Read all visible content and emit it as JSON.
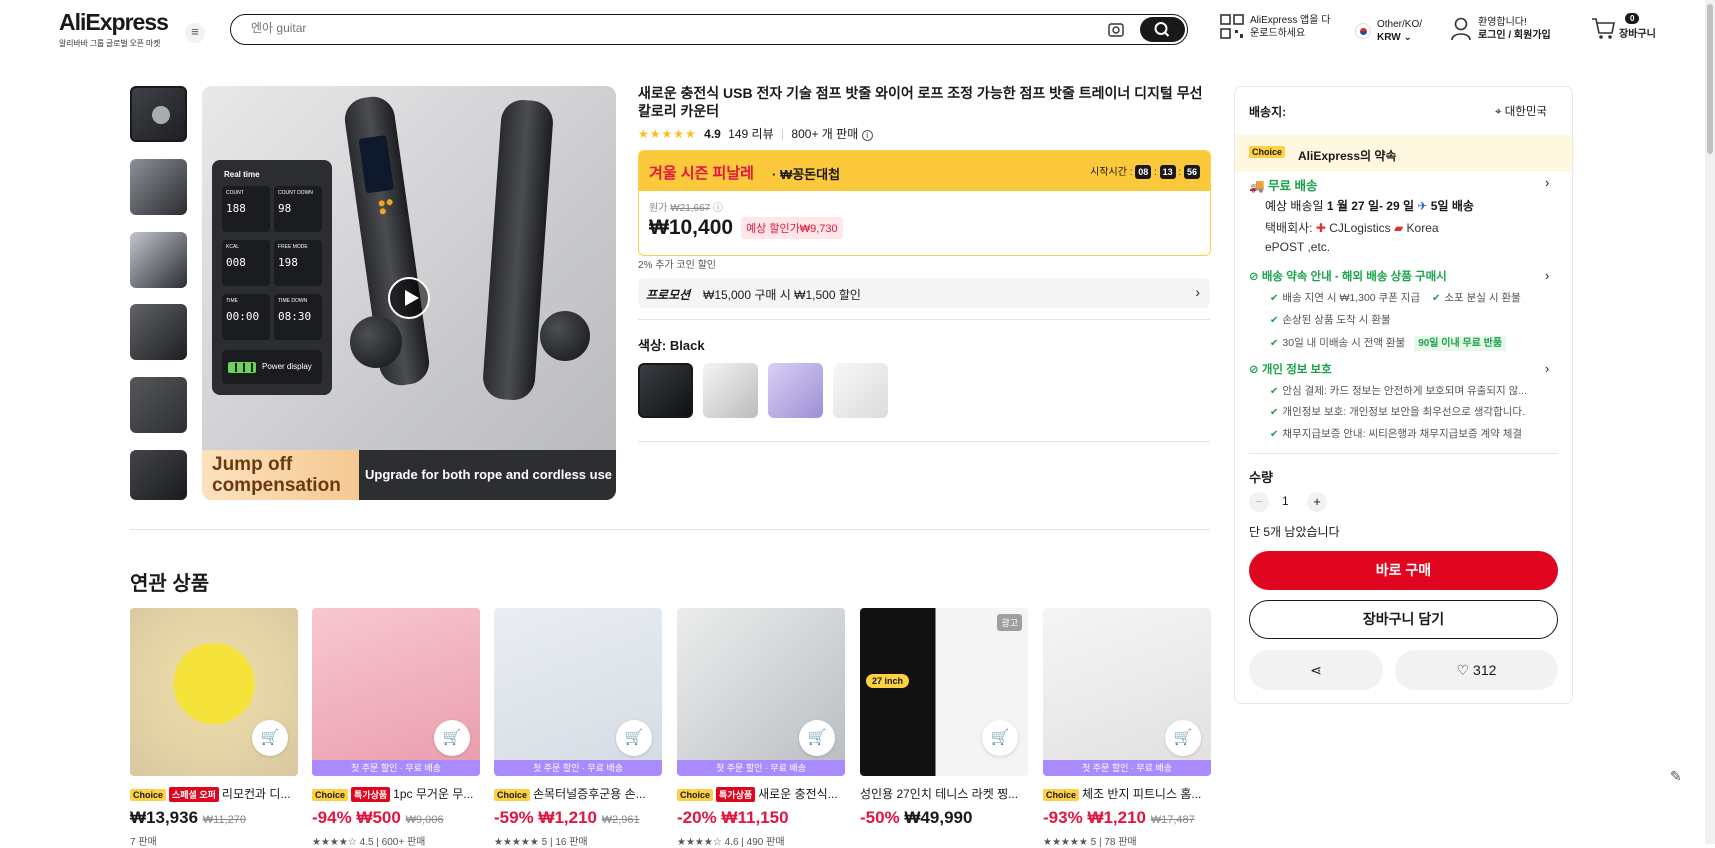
{
  "header": {
    "logo": "AliExpress",
    "logo_tagline": "알리바바 그룹 글로벌 오픈 마켓",
    "search_placeholder": "엔아 guitar",
    "app_line1": "AliExpress 앱을 다",
    "app_line2": "운로드하세요",
    "region_line1": "Other/KO/",
    "region_line2": "KRW",
    "account_line1": "환영합니다!",
    "account_line2": "로그인 / 회원가입",
    "cart_count": "0",
    "cart_label": "장바구니"
  },
  "gallery": {
    "thumb_count": 6,
    "main_text": {
      "real_time": "Real time",
      "count": "COUNT",
      "count_val": "188",
      "count_down": "COUNT DOWN",
      "count_down_val": "98",
      "kcal": "KCAL",
      "kcal_val": "008",
      "free_mode": "FREE MODE",
      "free_mode_val": "198",
      "time": "TIME",
      "time_val": "00:00",
      "time_down": "TIME DOWN",
      "time_down_val": "08:30",
      "power": "Power display",
      "banner_left": "Jump off compensation",
      "banner_right": "Upgrade for both rope and cordless use"
    }
  },
  "product": {
    "title": "새로운 충전식 USB 전자 기술 점프 밧줄 와이어 로프 조정 가능한 점프 밧줄 트레이너 디지털 무선 칼로리 카운터",
    "rating": "4.9",
    "reviews": "149 리뷰",
    "sold": "800+ 개 판매",
    "sale_title": "겨울 시즌 피날레",
    "sale_sub": " · ₩꽁돈대첩",
    "countdown_label": "시작시간 :",
    "countdown": [
      "08",
      "13",
      "56"
    ],
    "orig_label": "원가",
    "orig_price": "₩21,667",
    "price": "₩10,400",
    "discount_pill": "예상 할인가₩9,730",
    "coin_note": "2% 추가 코인 할인",
    "promo_label": "프로모션",
    "promo_text": "₩15,000 구매 시 ₩1,500 할인",
    "color_label": "색상:",
    "color_value": "Black",
    "swatch_count": 4
  },
  "shipping": {
    "ship_to_label": "배송지:",
    "ship_to": "대한민국",
    "choice": "Choice",
    "promise": "AliExpress의 약속",
    "free_ship": "무료 배송",
    "eta_prefix": "예상 배송일 ",
    "eta_dates": "1 월 27 일- 29 일",
    "eta_days": "5일 배송",
    "carrier_label": "택배회사:",
    "carrier1": "CJLogistics",
    "carrier2": "Korea",
    "carrier3": "ePOST ,etc.",
    "guide_title": "배송 약속 안내 - 해외 배송 상품 구매시",
    "guide_items": [
      "배송 지연 시 ₩1,300 쿠폰 지급",
      "소포 분실 시 환불",
      "손상된 상품 도착 시 환불",
      "30일 내 미배송 시 전액 환불"
    ],
    "guide_badge": "90일 이내 무료 반품",
    "privacy_title": "개인 정보 보호",
    "privacy_items": [
      "안심 결제: 카드 정보는 안전하게 보호되며 유출되지 않...",
      "개인정보 보호: 개인정보 보안을 최우선으로 생각합니다.",
      "채무지급보증 안내: 씨티은행과 채무지급보증 계약 체결"
    ],
    "qty_label": "수량",
    "qty": "1",
    "stock_note": "단 5개 남았습니다",
    "buy_now": "바로 구매",
    "add_cart": "장바구니 담기",
    "wish_count": "312"
  },
  "related": {
    "title": "연관 상품",
    "items": [
      {
        "tag2": "스페셜 오퍼",
        "name": "리모컨과 디...",
        "disc": "",
        "price": "₩13,936",
        "orig": "₩11,270",
        "meta": "7 판매",
        "band": ""
      },
      {
        "tag2": "특가상품",
        "name": "1pc 무거운 무...",
        "disc": "-94%",
        "price": "₩500",
        "orig": "₩9,006",
        "meta": "4.5 | 600+ 판매",
        "band": "첫 주문 할인 · 무료 배송"
      },
      {
        "tag2": "",
        "name": "손목터널증후군용 손...",
        "disc": "-59%",
        "price": "₩1,210",
        "orig": "₩2,961",
        "meta": "5 | 16 판매",
        "band": "첫 주문 할인 · 무료 배송"
      },
      {
        "tag2": "특가상품",
        "name": "새로운 충전식...",
        "disc": "-20%",
        "price": "₩11,150",
        "orig": "",
        "meta": "4.6 | 490 판매",
        "band": "첫 주문 할인 · 무료 배송"
      },
      {
        "tag2": "",
        "name": "성인용 27인치 테니스 라켓 찡...",
        "disc": "-50%",
        "price": "₩49,990",
        "orig": "",
        "meta": "",
        "band": "",
        "ad": "광고",
        "no_choice": true,
        "img_label": "27 inch"
      },
      {
        "tag2": "",
        "name": "체조 반지 피트니스 홈...",
        "disc": "-93%",
        "price": "₩1,210",
        "orig": "₩17,487",
        "meta": "5 | 78 판매",
        "band": "첫 주문 할인 · 무료 배송"
      }
    ],
    "choice_label": "Choice"
  },
  "colors": {
    "accent_red": "#e0061f",
    "choice_yellow": "#fdd141",
    "green": "#19a34a"
  }
}
